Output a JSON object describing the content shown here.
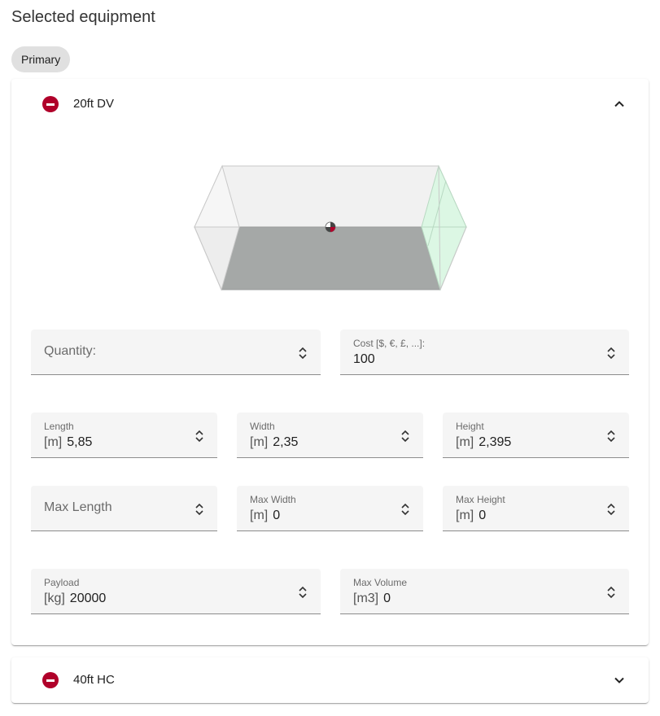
{
  "page": {
    "title": "Selected equipment"
  },
  "tabs": [
    {
      "label": "Primary"
    }
  ],
  "panels": [
    {
      "label": "20ft DV",
      "expanded": true,
      "fields": {
        "quantity": {
          "label": "Quantity:",
          "value": ""
        },
        "cost": {
          "label": "Cost [$, €, £, ...]:",
          "value": "100"
        },
        "length": {
          "label": "Length",
          "unit": "[m]",
          "value": "5,85"
        },
        "width": {
          "label": "Width",
          "unit": "[m]",
          "value": "2,35"
        },
        "height": {
          "label": "Height",
          "unit": "[m]",
          "value": "2,395"
        },
        "max_length": {
          "label": "Max Length",
          "value": ""
        },
        "max_width": {
          "label": "Max Width",
          "unit": "[m]",
          "value": "0"
        },
        "max_height": {
          "label": "Max Height",
          "unit": "[m]",
          "value": "0"
        },
        "payload": {
          "label": "Payload",
          "unit": "[kg]",
          "value": "20000"
        },
        "max_volume": {
          "label": "Max Volume",
          "unit": "[m3]",
          "value": "0"
        }
      }
    },
    {
      "label": "40ft HC",
      "expanded": false
    }
  ],
  "colors": {
    "remove": "#b0002a",
    "field_bg": "#f5f5f5",
    "chip_bg": "#e0e0e0",
    "floor": "#a5a8a7",
    "door": "#dcf7e4"
  },
  "icons": {
    "remove": "remove-circle-icon",
    "collapse": "chevron-up-icon",
    "expand": "chevron-down-icon",
    "stepper": "unfold-icon"
  }
}
